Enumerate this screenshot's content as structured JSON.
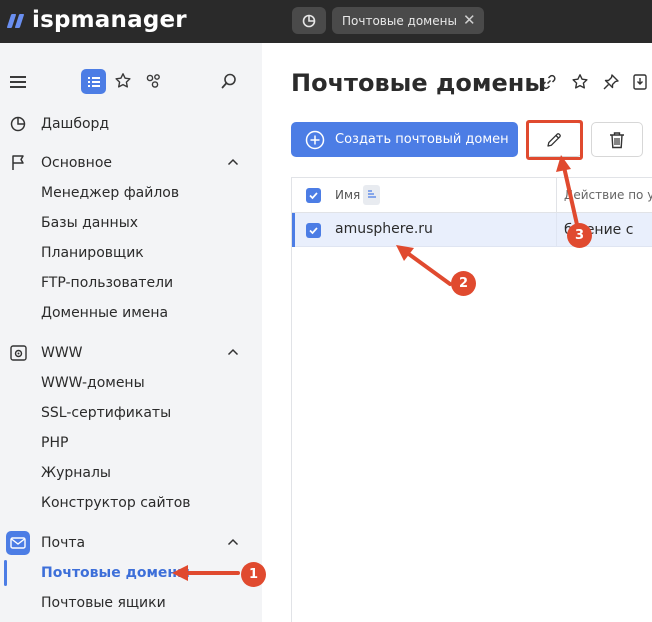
{
  "app": {
    "logo_text": "ispmanager"
  },
  "topbar": {
    "dashboard_tab_icon": "pie-chart-icon",
    "active_tab_label": "Почтовые домены",
    "close_icon": "close-icon"
  },
  "sidebar": {
    "sections": [
      {
        "label": "Дашборд",
        "icon": "pie-chart-icon"
      },
      {
        "label": "Основное",
        "icon": "flag-icon",
        "items": [
          "Менеджер файлов",
          "Базы данных",
          "Планировщик",
          "FTP-пользователи",
          "Доменные имена"
        ]
      },
      {
        "label": "WWW",
        "icon": "www-settings-icon",
        "items": [
          "WWW-домены",
          "SSL-сертификаты",
          "PHP",
          "Журналы",
          "Конструктор сайтов"
        ]
      },
      {
        "label": "Почта",
        "icon": "mail-icon",
        "items": [
          "Почтовые домены",
          "Почтовые ящики"
        ]
      }
    ],
    "active_item": "Почтовые домены"
  },
  "main": {
    "title": "Почтовые домены",
    "create_button_label": "Создать почтовый домен",
    "table": {
      "columns": [
        "Имя",
        "Действие по ум"
      ],
      "rows": [
        {
          "name": "amusphere.ru",
          "action": "бщение с"
        }
      ]
    }
  },
  "annotations": {
    "badges": [
      "1",
      "2",
      "3"
    ],
    "color": "#e04a2f"
  },
  "colors": {
    "accent": "#4c7de5",
    "topbar": "#2a2a2a",
    "annotation": "#e04a2f"
  }
}
